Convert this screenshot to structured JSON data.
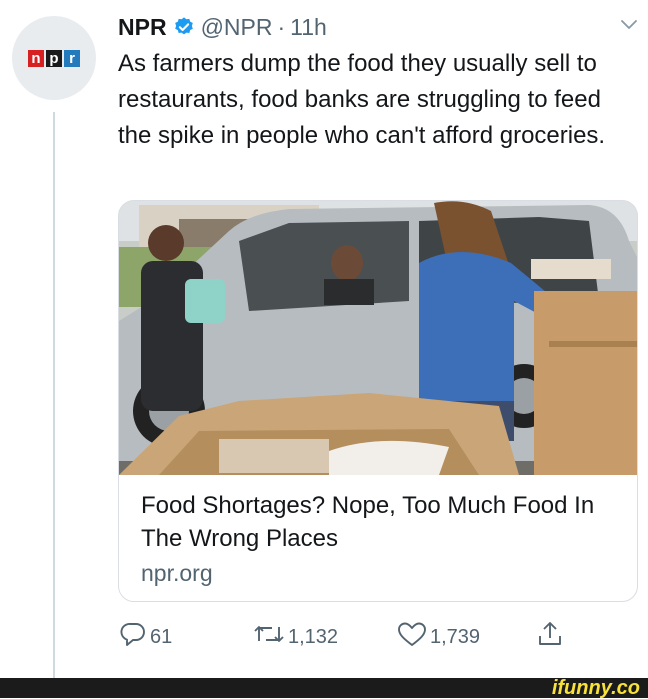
{
  "tweet": {
    "author_name": "NPR",
    "handle": "@NPR",
    "separator": "·",
    "time": "11h",
    "text": "As farmers dump the food they usually sell to restaurants, food banks are struggling to feed the spike in people who can't afford groceries."
  },
  "avatar": {
    "logo_letters": [
      "n",
      "p",
      "r"
    ]
  },
  "card": {
    "title": "Food Shortages? Nope, Too Much Food In The Wrong Places",
    "domain": "npr.org"
  },
  "actions": {
    "replies": "61",
    "retweets": "1,132",
    "likes": "1,739"
  },
  "icons": {
    "verified": "verified-badge-icon",
    "menu": "chevron-down-icon",
    "reply": "reply-icon",
    "retweet": "retweet-icon",
    "like": "heart-icon",
    "share": "share-icon"
  },
  "colors": {
    "verified_blue": "#1d9bf0",
    "secondary_text": "#536471",
    "npr_red": "#d62021",
    "npr_black": "#1a1a1a",
    "npr_blue": "#237bbd",
    "watermark_yellow": "#f8e13a"
  },
  "watermark": {
    "text": "ifunny.co"
  }
}
